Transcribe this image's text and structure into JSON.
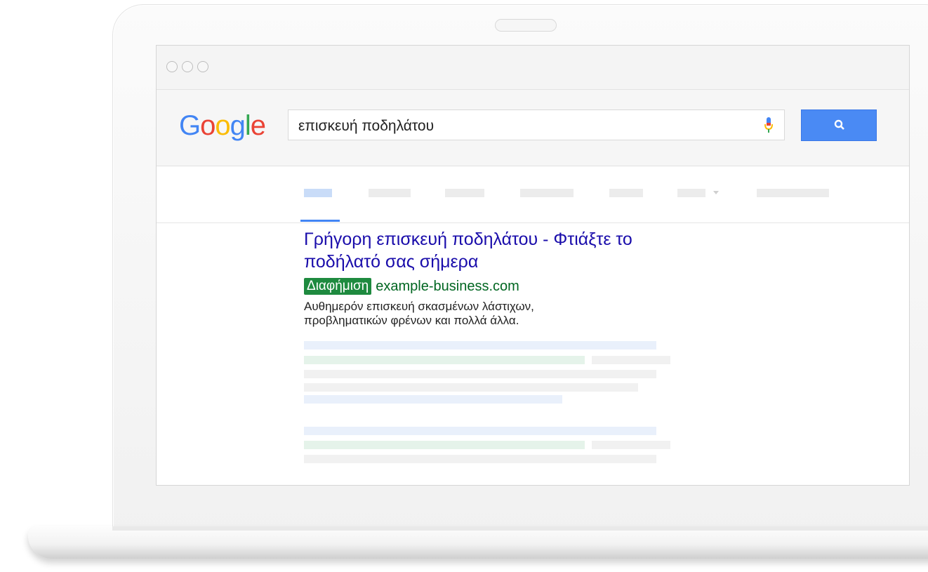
{
  "search": {
    "logo_letters": [
      "G",
      "o",
      "o",
      "g",
      "l",
      "e"
    ],
    "query": "επισκευή ποδηλάτου"
  },
  "icons": {
    "mic": "microphone-icon",
    "search": "search-icon"
  },
  "ad": {
    "title": "Γρήγορη επισκευή ποδηλάτου - Φτιάξτε το ποδήλατό σας σήμερα",
    "badge": "Διαφήμιση",
    "url": "example-business.com",
    "description_line1": "Αυθημερόν επισκευή σκασμένων λάστιχων,",
    "description_line2": "προβληματικών φρένων και πολλά άλλα."
  },
  "colors": {
    "link_title": "#1a0dab",
    "ad_badge": "#1e8a3f",
    "url_green": "#006621",
    "search_button": "#4a8af4"
  }
}
